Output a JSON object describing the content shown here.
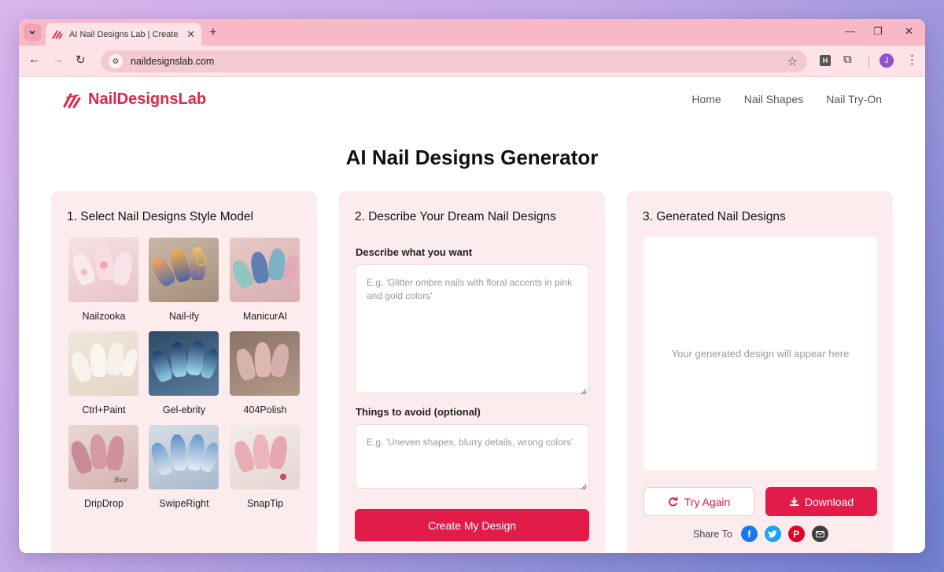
{
  "browser": {
    "tab_title": "AI Nail Designs Lab | Create Per",
    "url": "naildesignslab.com",
    "profile_initial": "J",
    "extension_letter": "H"
  },
  "site": {
    "brand": "NailDesignsLab",
    "brand_color": "#e0264b",
    "nav": [
      "Home",
      "Nail Shapes",
      "Nail Try-On"
    ]
  },
  "page": {
    "title": "AI Nail Designs Generator"
  },
  "step1": {
    "heading": "1. Select Nail Designs Style Model",
    "styles": [
      {
        "label": "Nailzooka"
      },
      {
        "label": "Nail-ify"
      },
      {
        "label": "ManicurAI"
      },
      {
        "label": "Ctrl+Paint"
      },
      {
        "label": "Gel-ebrity"
      },
      {
        "label": "404Polish"
      },
      {
        "label": "DripDrop"
      },
      {
        "label": "SwipeRight"
      },
      {
        "label": "SnapTip"
      }
    ]
  },
  "step2": {
    "heading": "2. Describe Your Dream Nail Designs",
    "describe_label": "Describe what you want",
    "describe_placeholder": "E.g. 'Glitter ombre nails with floral accents in pink and gold colors'",
    "avoid_label": "Things to avoid (optional)",
    "avoid_placeholder": "E.g. 'Uneven shapes, blurry details, wrong colors'",
    "button": "Create My Design"
  },
  "step3": {
    "heading": "3. Generated Nail Designs",
    "empty_text": "Your generated design will appear here",
    "try_again": "Try Again",
    "download": "Download",
    "share_label": "Share To",
    "socials": [
      "facebook-icon",
      "twitter-icon",
      "pinterest-icon",
      "email-icon"
    ]
  },
  "colors": {
    "accent": "#e21c48",
    "card_bg": "#fdeced"
  }
}
